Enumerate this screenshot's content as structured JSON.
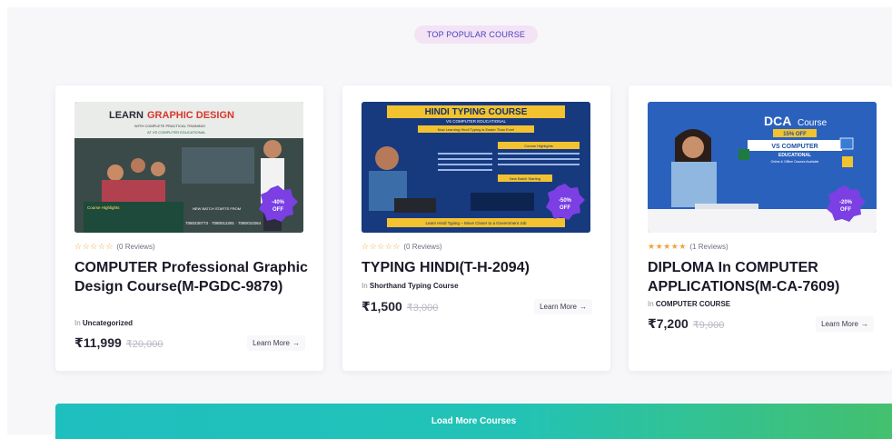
{
  "section": {
    "tag": "TOP POPULAR COURSE"
  },
  "cards": [
    {
      "thumb": {
        "headline_a": "LEARN",
        "headline_b": "GRAPHIC DESIGN",
        "sub_a": "WITH COMPLETE PRACTICAL TRAINING!",
        "sub_b": "AT VS COMPUTER EDUCATIONAL",
        "highlights": "Course Highlights",
        "batch": "NEW BATCH STARTS FROM",
        "phones": "7080230773 · 7080012291 · 7080010264",
        "discount": "-40%",
        "discount_off": "OFF"
      },
      "reviews": "(0 Reviews)",
      "rating": 0,
      "title": "COMPUTER Professional Graphic Design Course(M-PGDC-9879)",
      "category_prefix": "In",
      "category": "Uncategorized",
      "price": "₹11,999",
      "old_price": "₹20,000",
      "learn_more": "Learn More",
      "arrow": "→"
    },
    {
      "thumb": {
        "headline_a": "HINDI TYPING COURSE",
        "sub_a": "VS COMPUTER EDUCATIONAL",
        "sub_b": "Now Learning Hindi Typing is Easier Than Ever!",
        "highlights": "Course Highlights",
        "batch": "New Batch Starting",
        "footer": "Learn Hindi Typing – Move Closer to a Government Job",
        "discount": "-50%",
        "discount_off": "OFF"
      },
      "reviews": "(0 Reviews)",
      "rating": 0,
      "title": "TYPING HINDI(T-H-2094)",
      "category_prefix": "In",
      "category": "Shorthand Typing Course",
      "price": "₹1,500",
      "old_price": "₹3,000",
      "learn_more": "Learn More",
      "arrow": "→"
    },
    {
      "thumb": {
        "headline_a": "DCA",
        "headline_b": "Course",
        "offer": "15% OFF",
        "sub_a": "VS COMPUTER",
        "sub_b": "EDUCATIONAL",
        "sub_c": "Online & Offline Classes Available",
        "discount": "-20%",
        "discount_off": "OFF"
      },
      "reviews": "(1 Reviews)",
      "rating": 5,
      "title": "DIPLOMA In COMPUTER APPLICATIONS(M-CA-7609)",
      "category_prefix": "In",
      "category": "COMPUTER COURSE",
      "price": "₹7,200",
      "old_price": "₹9,000",
      "learn_more": "Learn More",
      "arrow": "→"
    }
  ],
  "load_more": "Load More Courses",
  "colors": {
    "accent_teal": "#1ebfbf",
    "accent_green": "#44c06e",
    "tag_bg": "#f3e3f5",
    "tag_text": "#4b3fbf",
    "star": "#f2a33a",
    "badge": "#7b3fe4"
  },
  "icons": {
    "star": "star-icon",
    "arrow": "arrow-right-icon"
  }
}
